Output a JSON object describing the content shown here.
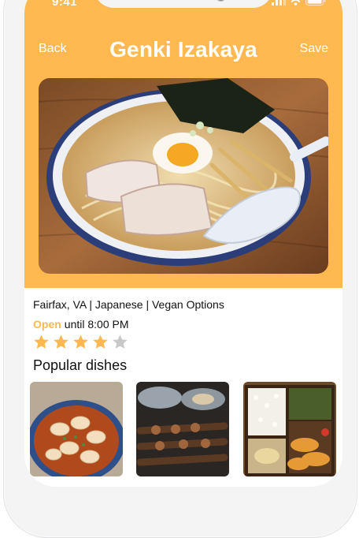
{
  "status_bar": {
    "time": "9:41",
    "icons": [
      "signal-icon",
      "wifi-icon",
      "battery-icon"
    ]
  },
  "nav": {
    "back_label": "Back",
    "title": "Genki Izakaya",
    "save_label": "Save"
  },
  "restaurant": {
    "meta": "Fairfax, VA | Japanese | Vegan Options",
    "open_label": "Open",
    "hours_text": "until 8:00 PM",
    "rating": 4,
    "rating_max": 5
  },
  "popular_dishes": {
    "title": "Popular dishes",
    "count_visible": 3
  },
  "colors": {
    "accent": "#ffb950",
    "star_filled": "#ffb950",
    "star_empty": "#c8c8c8",
    "text": "#111111"
  }
}
